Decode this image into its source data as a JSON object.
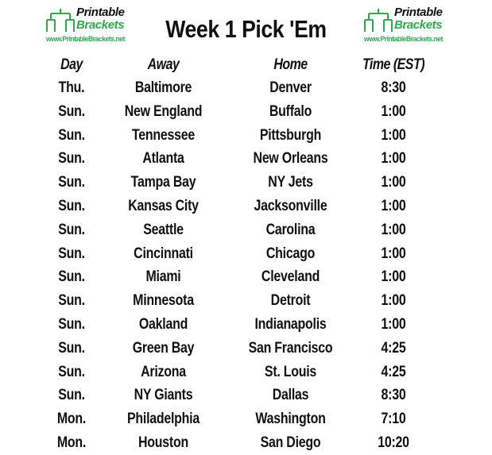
{
  "document": {
    "title": "Week 1 Pick 'Em"
  },
  "logo": {
    "word1": "Printable",
    "word2": "Brackets",
    "url": "www.PrintableBrackets.net",
    "mark": "tournament-bracket-icon",
    "colors": {
      "green": "#2fa84f",
      "black": "#111111"
    }
  },
  "table": {
    "headers": {
      "day": "Day",
      "away": "Away",
      "home": "Home",
      "time": "Time (EST)"
    },
    "rows": [
      {
        "day": "Thu.",
        "away": "Baltimore",
        "home": "Denver",
        "time": "8:30"
      },
      {
        "day": "Sun.",
        "away": "New England",
        "home": "Buffalo",
        "time": "1:00"
      },
      {
        "day": "Sun.",
        "away": "Tennessee",
        "home": "Pittsburgh",
        "time": "1:00"
      },
      {
        "day": "Sun.",
        "away": "Atlanta",
        "home": "New Orleans",
        "time": "1:00"
      },
      {
        "day": "Sun.",
        "away": "Tampa Bay",
        "home": "NY Jets",
        "time": "1:00"
      },
      {
        "day": "Sun.",
        "away": "Kansas City",
        "home": "Jacksonville",
        "time": "1:00"
      },
      {
        "day": "Sun.",
        "away": "Seattle",
        "home": "Carolina",
        "time": "1:00"
      },
      {
        "day": "Sun.",
        "away": "Cincinnati",
        "home": "Chicago",
        "time": "1:00"
      },
      {
        "day": "Sun.",
        "away": "Miami",
        "home": "Cleveland",
        "time": "1:00"
      },
      {
        "day": "Sun.",
        "away": "Minnesota",
        "home": "Detroit",
        "time": "1:00"
      },
      {
        "day": "Sun.",
        "away": "Oakland",
        "home": "Indianapolis",
        "time": "1:00"
      },
      {
        "day": "Sun.",
        "away": "Green Bay",
        "home": "San Francisco",
        "time": "4:25"
      },
      {
        "day": "Sun.",
        "away": "Arizona",
        "home": "St. Louis",
        "time": "4:25"
      },
      {
        "day": "Sun.",
        "away": "NY Giants",
        "home": "Dallas",
        "time": "8:30"
      },
      {
        "day": "Mon.",
        "away": "Philadelphia",
        "home": "Washington",
        "time": "7:10"
      },
      {
        "day": "Mon.",
        "away": "Houston",
        "home": "San Diego",
        "time": "10:20"
      }
    ]
  }
}
